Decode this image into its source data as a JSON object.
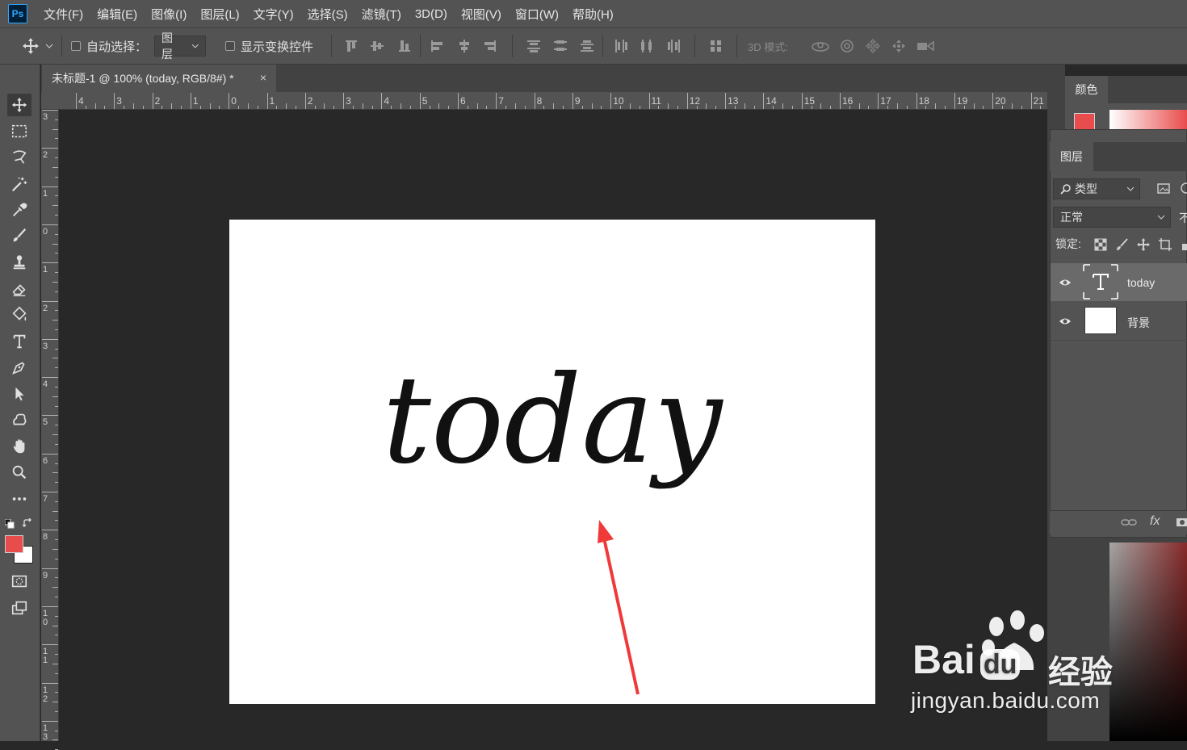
{
  "menu": {
    "app_logo": "Ps",
    "items": [
      "文件(F)",
      "编辑(E)",
      "图像(I)",
      "图层(L)",
      "文字(Y)",
      "选择(S)",
      "滤镜(T)",
      "3D(D)",
      "视图(V)",
      "窗口(W)",
      "帮助(H)"
    ]
  },
  "options": {
    "auto_select_label": "自动选择：",
    "auto_select_checked": false,
    "auto_select_target": "图层",
    "show_transform_label": "显示变换控件",
    "show_transform_checked": false,
    "mode_3d_label": "3D 模式:"
  },
  "document": {
    "tab_title": "未标题-1 @ 100% (today, RGB/8#) *",
    "close_glyph": "×",
    "canvas_text": "today"
  },
  "rulers": {
    "top_labels": [
      "4",
      "3",
      "2",
      "1",
      "0",
      "1",
      "2",
      "3",
      "4",
      "5",
      "6",
      "7",
      "8",
      "9",
      "10",
      "11",
      "12",
      "13",
      "14",
      "15",
      "16",
      "17",
      "18",
      "19",
      "20",
      "21"
    ],
    "left_labels": [
      "3",
      "2",
      "1",
      "0",
      "1",
      "2",
      "3",
      "4",
      "5",
      "6",
      "7",
      "8",
      "9",
      "10",
      "11",
      "12",
      "13"
    ]
  },
  "panels": {
    "color_tab": "颜色",
    "foreground_color": "#e84c4c",
    "layers_tab": "图层",
    "filter_kind": "类型",
    "blend_mode": "正常",
    "opacity_label_partial": "不",
    "lock_label": "锁定:",
    "layers": [
      {
        "name": "today",
        "type": "text",
        "selected": true,
        "visible": true
      },
      {
        "name": "背景",
        "type": "background",
        "selected": false,
        "visible": true
      }
    ],
    "bottom_fx": "fx"
  },
  "watermark": {
    "brand": "Bai",
    "brand_suffix": "du",
    "jingyan": "经验",
    "url": "jingyan.baidu.com"
  }
}
